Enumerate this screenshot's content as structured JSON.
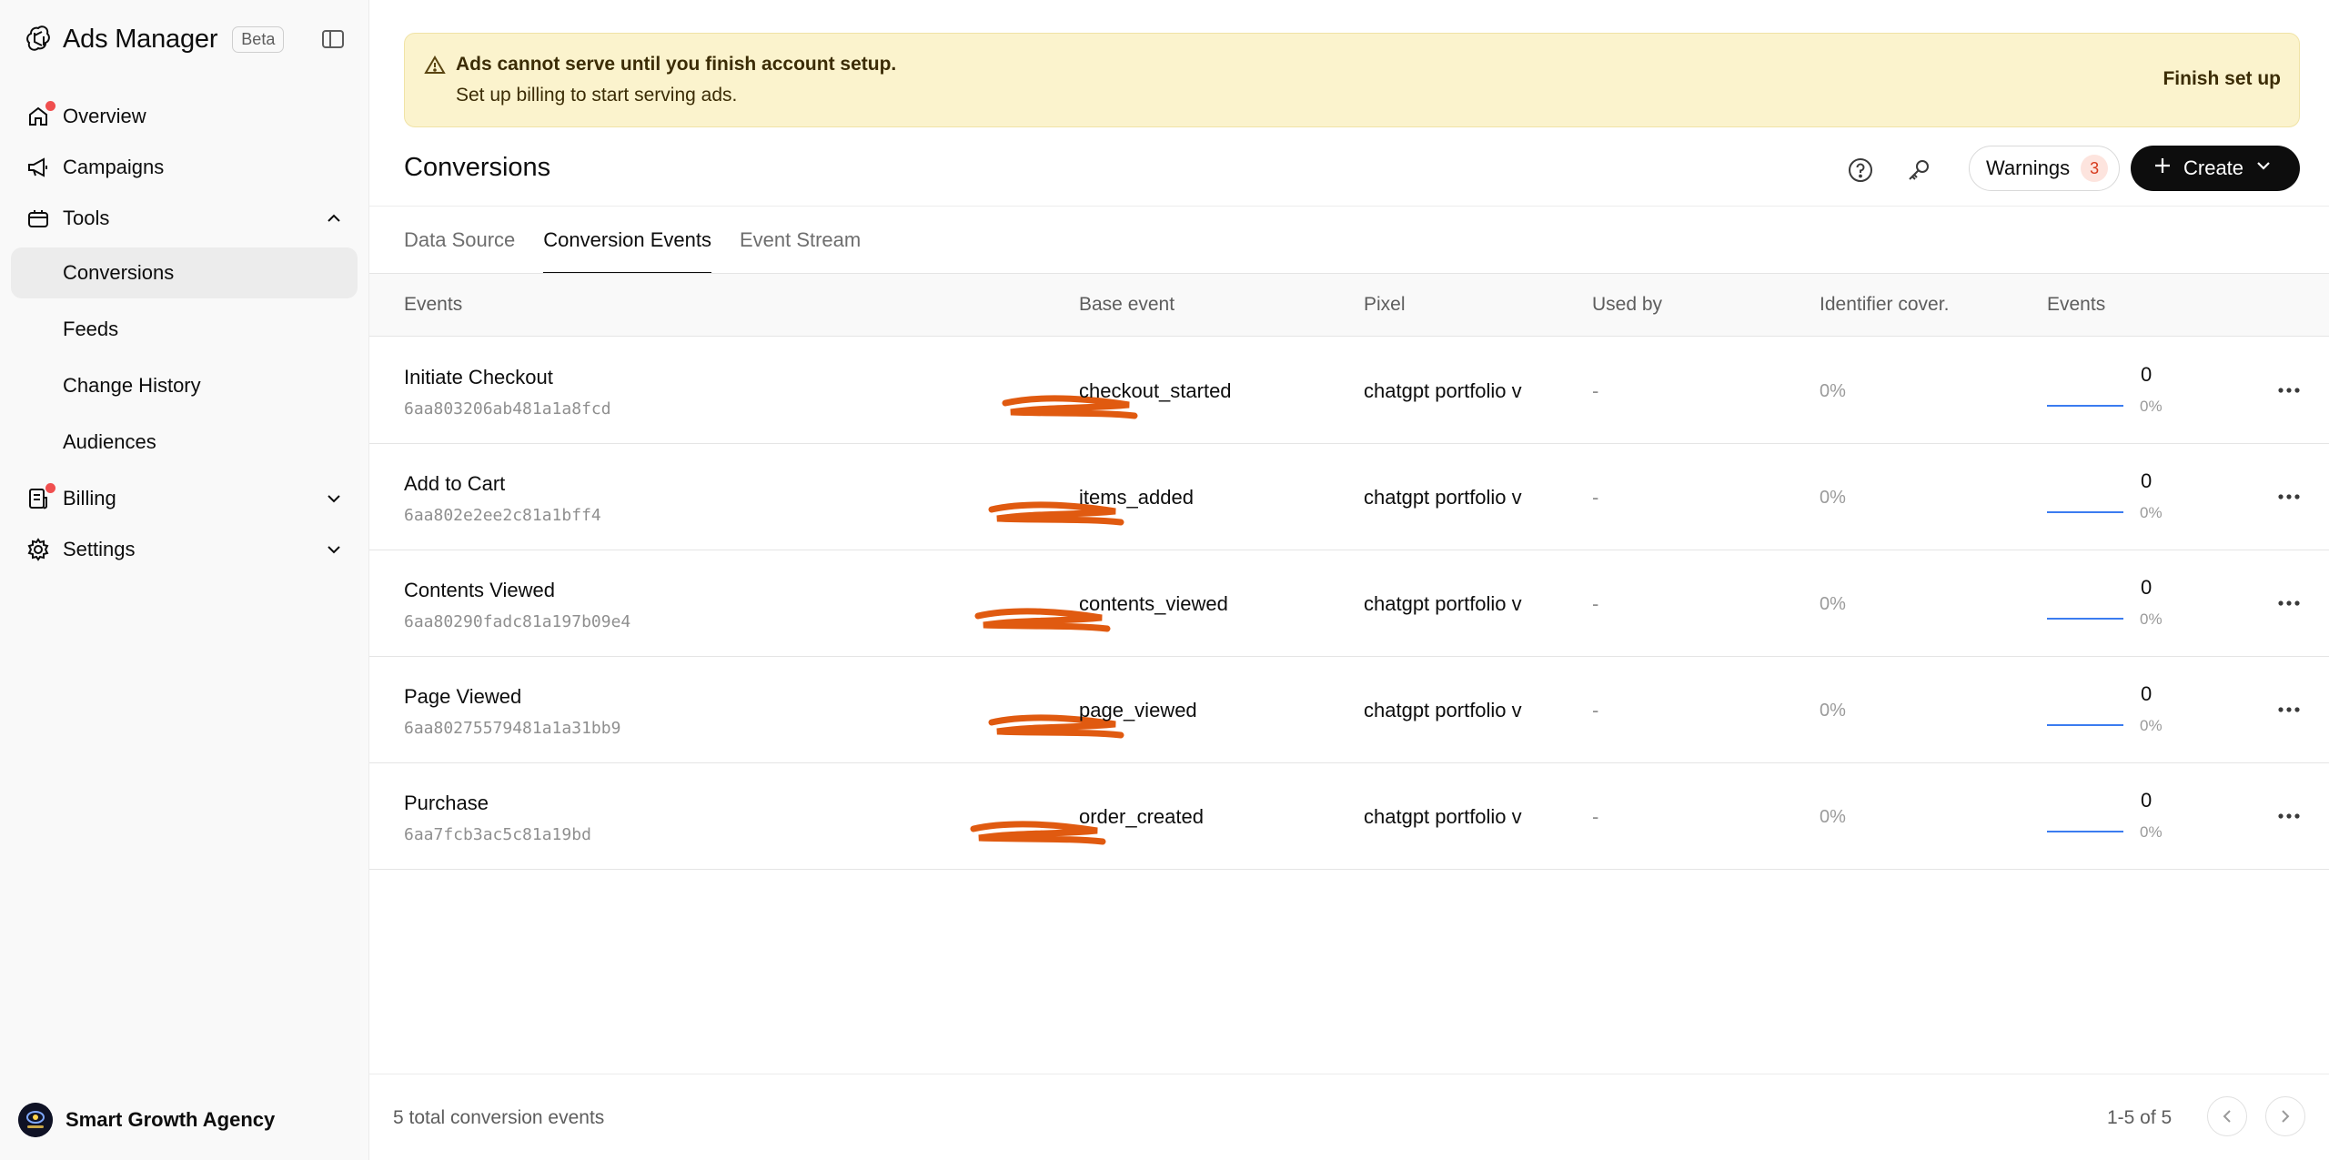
{
  "app": {
    "title": "Ads Manager",
    "badge": "Beta"
  },
  "sidebar": {
    "items": [
      {
        "label": "Overview",
        "icon": "home-icon",
        "dot": true
      },
      {
        "label": "Campaigns",
        "icon": "megaphone-icon"
      },
      {
        "label": "Tools",
        "icon": "tools-icon",
        "expanded": true
      },
      {
        "label": "Billing",
        "icon": "receipt-icon",
        "dot": true
      },
      {
        "label": "Settings",
        "icon": "gear-icon"
      }
    ],
    "tools_sub": [
      "Conversions",
      "Feeds",
      "Change History",
      "Audiences"
    ],
    "active_sub": "Conversions",
    "org_name": "Smart Growth Agency"
  },
  "banner": {
    "title": "Ads cannot serve until you finish account setup.",
    "subtitle": "Set up billing to start serving ads.",
    "action": "Finish set up"
  },
  "header": {
    "title": "Conversions",
    "warnings_label": "Warnings",
    "warnings_count": "3",
    "create_label": "Create"
  },
  "tabs": [
    "Data Source",
    "Conversion Events",
    "Event Stream"
  ],
  "active_tab": "Conversion Events",
  "table": {
    "columns": [
      "Events",
      "Base event",
      "Pixel",
      "Used by",
      "Identifier cover.",
      "Events"
    ],
    "rows": [
      {
        "name": "Initiate Checkout",
        "id": "6aa803206ab481a1a8fcd",
        "base": "checkout_started",
        "pixel": "chatgpt portfolio v",
        "used_by": "-",
        "coverage": "0%",
        "events": "0",
        "events_pct": "0%"
      },
      {
        "name": "Add to Cart",
        "id": "6aa802e2ee2c81a1bff4",
        "base": "items_added",
        "pixel": "chatgpt portfolio v",
        "used_by": "-",
        "coverage": "0%",
        "events": "0",
        "events_pct": "0%"
      },
      {
        "name": "Contents Viewed",
        "id": "6aa80290fadc81a197b09e4",
        "base": "contents_viewed",
        "pixel": "chatgpt portfolio v",
        "used_by": "-",
        "coverage": "0%",
        "events": "0",
        "events_pct": "0%"
      },
      {
        "name": "Page Viewed",
        "id": "6aa80275579481a1a31bb9",
        "base": "page_viewed",
        "pixel": "chatgpt portfolio v",
        "used_by": "-",
        "coverage": "0%",
        "events": "0",
        "events_pct": "0%"
      },
      {
        "name": "Purchase",
        "id": "6aa7fcb3ac5c81a19bd",
        "base": "order_created",
        "pixel": "chatgpt portfolio v",
        "used_by": "-",
        "coverage": "0%",
        "events": "0",
        "events_pct": "0%"
      }
    ]
  },
  "footer": {
    "total": "5 total conversion events",
    "range": "1-5 of 5"
  },
  "colors": {
    "redaction": "#e05a10",
    "banner_bg": "#fbf3cd",
    "accent_blue": "#3b7cf0",
    "badge_red": "#f04f4f"
  }
}
